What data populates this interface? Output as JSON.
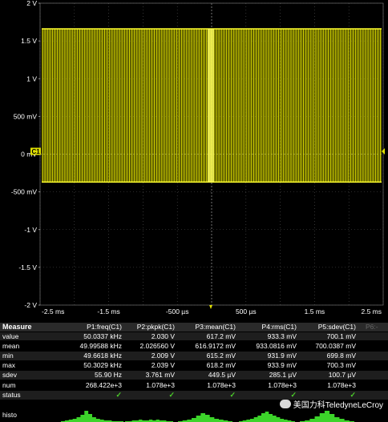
{
  "scope": {
    "y_labels": [
      "2 V",
      "1.5 V",
      "1 V",
      "500 mV",
      "0 mV",
      "-500 mV",
      "-1 V",
      "-1.5 V",
      "-2 V"
    ],
    "x_labels": [
      "-2.5 ms",
      "-1.5 ms",
      "-500 µs",
      "500 µs",
      "1.5 ms",
      "2.5 ms"
    ],
    "channel_marker": "C1",
    "trace_color": "#d6d600",
    "signal_high_v": 1.66,
    "signal_low_v": -0.37
  },
  "measure": {
    "title": "Measure",
    "columns": [
      "P1:freq(C1)",
      "P2:pkpk(C1)",
      "P3:mean(C1)",
      "P4:rms(C1)",
      "P5:sdev(C1)",
      "P6:-"
    ],
    "rows": [
      {
        "label": "value",
        "cells": [
          "50.0337 kHz",
          "2.030 V",
          "617.2 mV",
          "933.3 mV",
          "700.1 mV"
        ]
      },
      {
        "label": "mean",
        "cells": [
          "49.99588 kHz",
          "2.026560 V",
          "616.9172 mV",
          "933.0816 mV",
          "700.0387 mV"
        ]
      },
      {
        "label": "min",
        "cells": [
          "49.6618 kHz",
          "2.009 V",
          "615.2 mV",
          "931.9 mV",
          "699.8 mV"
        ]
      },
      {
        "label": "max",
        "cells": [
          "50.3029 kHz",
          "2.039 V",
          "618.2 mV",
          "933.9 mV",
          "700.3 mV"
        ]
      },
      {
        "label": "sdev",
        "cells": [
          "55.90 Hz",
          "3.761 mV",
          "449.5 µV",
          "285.1 µV",
          "100.7 µV"
        ]
      },
      {
        "label": "num",
        "cells": [
          "268.422e+3",
          "1.078e+3",
          "1.078e+3",
          "1.078e+3",
          "1.078e+3"
        ]
      }
    ],
    "status_label": "status",
    "status_icon": "checkmark-icon",
    "status_check": "✓",
    "histo_label": "histo",
    "histo_color": "#3cd42a"
  },
  "watermark": {
    "text": "美国力科TeledyneLeCroy"
  }
}
